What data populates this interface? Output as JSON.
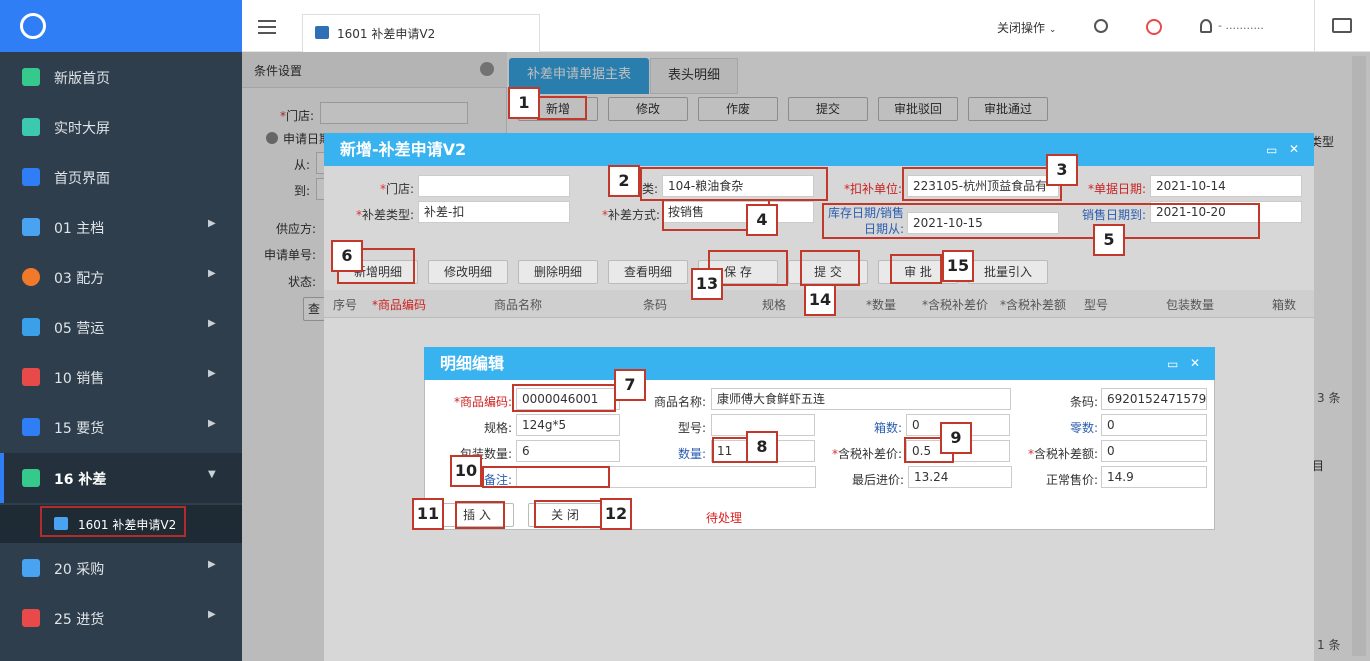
{
  "sidebar": {
    "items": [
      {
        "label": "新版首页",
        "icon": "m-logo-icon",
        "color": "#35c98c"
      },
      {
        "label": "实时大屏",
        "icon": "datav-icon",
        "color": "#3cc9b0"
      },
      {
        "label": "首页界面",
        "icon": "home-icon",
        "color": "#2f7ef5"
      },
      {
        "label": "01 主档",
        "icon": "database-icon",
        "color": "#4aa3f0"
      },
      {
        "label": "03 配方",
        "icon": "formula-icon",
        "color": "#f07a2a"
      },
      {
        "label": "05 营运",
        "icon": "monitor-icon",
        "color": "#3aa0e8"
      },
      {
        "label": "10 销售",
        "icon": "sale-icon",
        "color": "#e84a4a"
      },
      {
        "label": "15 要货",
        "icon": "shopping-bag-icon",
        "color": "#2f7ef5"
      },
      {
        "label": "16 补差",
        "icon": "clipboard-icon",
        "color": "#35c98c"
      },
      {
        "label": "20 采购",
        "icon": "basket-icon",
        "color": "#4aa3f0"
      },
      {
        "label": "25 进货",
        "icon": "truck-icon",
        "color": "#e84a4a"
      }
    ],
    "sub_item": "1601 补差申请V2"
  },
  "topbar": {
    "tab_title": "1601 补差申请V2",
    "close_ops": "关闭操作",
    "user_name": "- ..........."
  },
  "cond": {
    "title": "条件设置",
    "store": "门店:",
    "apply_date": "申请日期",
    "from": "从:",
    "to": "到:",
    "supplier": "供应方:",
    "apply_no": "申请单号:",
    "status": "状态:",
    "query": "查"
  },
  "main": {
    "tab1": "补差申请单据主表",
    "tab2": "表头明细",
    "buttons": [
      "新增",
      "修改",
      "作废",
      "提交",
      "审批驳回",
      "审批通过"
    ],
    "right_col": "类型",
    "count_top": "3 条",
    "right_mid": "目",
    "count_bottom": "1 条"
  },
  "dlg1": {
    "title": "新增-补差申请V2",
    "store_label": "门店:",
    "category_label": "类:",
    "category_value": "104-粮油食杂",
    "deduct_unit_label": "扣补单位:",
    "deduct_unit_value": "223105-杭州顶益食品有",
    "doc_date_label": "单据日期:",
    "doc_date_value": "2021-10-14",
    "type_label": "补差类型:",
    "type_value": "补差-扣",
    "method_label": "补差方式:",
    "method_value": "按销售",
    "stock_date_label": "库存日期/销售日期从:",
    "stock_date_value": "2021-10-15",
    "sale_date_to_label": "销售日期到:",
    "sale_date_to_value": "2021-10-20",
    "buttons": [
      "新增明细",
      "修改明细",
      "删除明细",
      "查看明细",
      "保 存",
      "提 交",
      "审 批",
      "批量引入"
    ],
    "grid_cols": [
      "序号",
      "商品编码",
      "商品名称",
      "条码",
      "规格",
      "数量",
      "含税补差价",
      "含税补差额",
      "型号",
      "包装数量",
      "箱数"
    ]
  },
  "dlg2": {
    "title": "明细编辑",
    "code_label": "商品编码:",
    "code_value": "0000046001",
    "name_label": "商品名称:",
    "name_value": "康师傅大食鲜虾五连",
    "barcode_label": "条码:",
    "barcode_value": "6920152471579",
    "spec_label": "规格:",
    "spec_value": "124g*5",
    "model_label": "型号:",
    "model_value": "",
    "box_label": "箱数:",
    "box_value": "0",
    "loose_label": "零数:",
    "loose_value": "0",
    "pack_label": "包装数量:",
    "pack_value": "6",
    "qty_label": "数量:",
    "qty_value": "11",
    "price_label": "含税补差价:",
    "price_value": "0.5",
    "amount_label": "含税补差额:",
    "amount_value": "0",
    "remark_label": "备注:",
    "remark_value": "",
    "last_price_label": "最后进价:",
    "last_price_value": "13.24",
    "sale_price_label": "正常售价:",
    "sale_price_value": "14.9",
    "insert_btn": "插 入",
    "close_btn": "关 闭",
    "status": "待处理"
  },
  "callouts": [
    "1",
    "2",
    "3",
    "4",
    "5",
    "6",
    "7",
    "8",
    "9",
    "10",
    "11",
    "12",
    "13",
    "14",
    "15"
  ]
}
